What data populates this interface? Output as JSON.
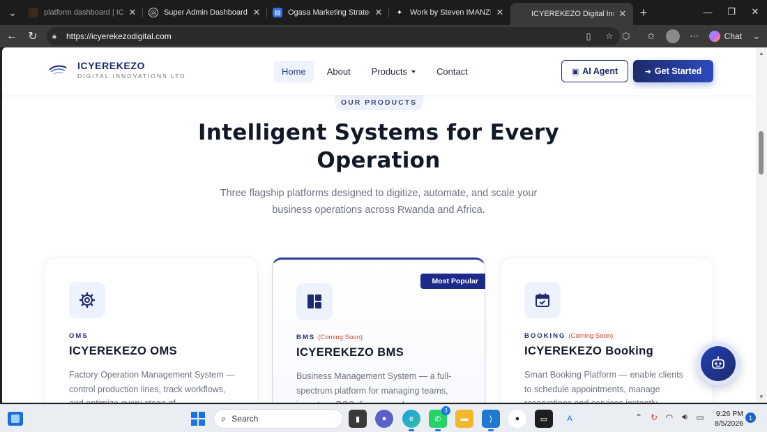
{
  "browser": {
    "tabs": [
      {
        "title": "platform dashboard | ICYEREKEZO",
        "fav_color": "#3a2a1a",
        "fav_glyph": ""
      },
      {
        "title": "Super Admin Dashboard - ICYEREKEZO",
        "fav_color": "#ffffff",
        "fav_glyph": "◎"
      },
      {
        "title": "Ogasa Marketing Strategy Plan",
        "fav_color": "#2f6fe4",
        "fav_glyph": "▤"
      },
      {
        "title": "Work by Steven IMANZI",
        "fav_color": "#ffffff",
        "fav_glyph": "✦"
      },
      {
        "title": "ICYEREKEZO Digital Innovations",
        "fav_color": "#2a2a2a",
        "fav_glyph": ""
      }
    ],
    "url": "https://icyerekezodigital.com",
    "chat_label": "Chat"
  },
  "site": {
    "brand_name": "ICYEREKEZO",
    "brand_sub": "DIGITAL INNOVATIONS LTD",
    "nav": [
      {
        "label": "Home",
        "active": true
      },
      {
        "label": "About"
      },
      {
        "label": "Products",
        "dropdown": true
      },
      {
        "label": "Contact"
      }
    ],
    "ai_agent_label": "AI Agent",
    "get_started_label": "Get Started"
  },
  "hero": {
    "eyebrow": "OUR PRODUCTS",
    "title_line1": "Intelligent Systems for Every",
    "title_line2": "Operation",
    "subtitle_line1": "Three flagship platforms designed to digitize, automate, and scale your",
    "subtitle_line2": "business operations across Rwanda and Africa."
  },
  "cards": [
    {
      "tag": "OMS",
      "soon": "",
      "title": "ICYEREKEZO OMS",
      "desc": "Factory Operation Management System — control production lines, track workflows, and optimize every stage of",
      "icon": "gear-icon"
    },
    {
      "tag": "BMS",
      "soon": "(Coming Soon)",
      "title": "ICYEREKEZO BMS",
      "desc": "Business Management System — a full-spectrum platform for managing teams, inventory, POS, finance and",
      "badge": "Most Popular",
      "icon": "dashboard-icon"
    },
    {
      "tag": "BOOKING",
      "soon": "(Coming Soon)",
      "title": "ICYEREKEZO Booking",
      "desc": "Smart Booking Platform — enable clients to schedule appointments, manage reservations and services instantly",
      "icon": "calendar-check-icon"
    }
  ],
  "taskbar": {
    "search_placeholder": "Search",
    "whatsapp_count": "3",
    "time": "9:26 PM",
    "date": "8/5/2026",
    "notifications": "1"
  }
}
